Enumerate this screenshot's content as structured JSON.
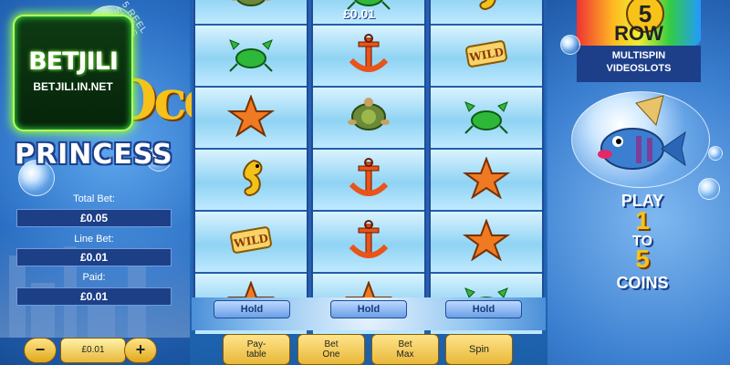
{
  "brand": {
    "name": "BETJILI",
    "url": "BETJILI.IN.NET"
  },
  "game": {
    "title_top": "Ocean",
    "title_bottom": "PRINCESS",
    "arc_text": "5 REEL SLOTS"
  },
  "stats": {
    "total_bet_label": "Total Bet:",
    "total_bet_value": "£0.05",
    "line_bet_label": "Line Bet:",
    "line_bet_value": "£0.01",
    "paid_label": "Paid:",
    "paid_value": "£0.01"
  },
  "bet_control": {
    "minus": "−",
    "value": "£0.01",
    "plus": "+"
  },
  "win_amount": "£0.01",
  "reels": [
    [
      "turtle",
      "crab",
      "starfish",
      "seahorse",
      "wild",
      "starfish"
    ],
    [
      "crab",
      "anchor",
      "turtle",
      "anchor",
      "anchor",
      "starfish"
    ],
    [
      "seahorse",
      "wild",
      "crab",
      "starfish",
      "starfish",
      "crab"
    ]
  ],
  "hold_buttons": [
    "Hold",
    "Hold",
    "Hold"
  ],
  "bottom_buttons": [
    {
      "line1": "Pay-",
      "line2": "table"
    },
    {
      "line1": "Bet",
      "line2": "One"
    },
    {
      "line1": "Bet",
      "line2": "Max"
    },
    {
      "line1": "Spin",
      "line2": ""
    }
  ],
  "right_panel": {
    "row_number": "5",
    "row_word": "ROW",
    "sub_line1": "MULTISPIN",
    "sub_line2": "VIDEOSLOTS",
    "play": "PLAY",
    "num_1": "1",
    "to": "TO",
    "num_5": "5",
    "coins": "COINS"
  },
  "colors": {
    "accent": "#f6c21a",
    "panel_blue": "#1d3f8a",
    "brand_green": "#8cff3a"
  }
}
